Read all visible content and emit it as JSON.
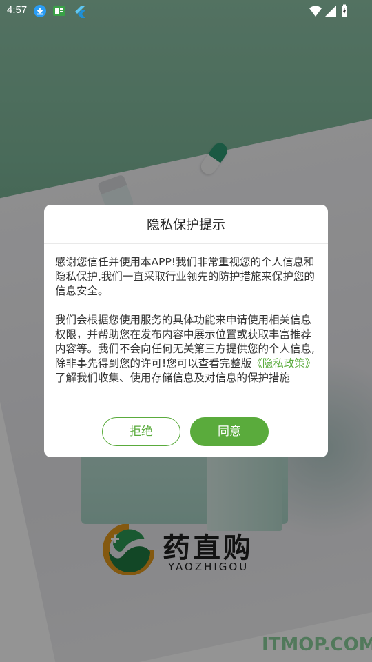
{
  "status_bar": {
    "time": "4:57",
    "left_icons": [
      "download-icon",
      "news-icon",
      "flutter-icon"
    ],
    "right_icons": [
      "wifi-icon",
      "signal-icon",
      "battery-icon"
    ]
  },
  "dialog": {
    "title": "隐私保护提示",
    "paragraph1": "感谢您信任并使用本APP!我们非常重视您的个人信息和隐私保护,我们一直采取行业领先的防护措施来保护您的信息安全。",
    "paragraph2_before": "我们会根据您使用服务的具体功能来申请使用相关信息权限，并帮助您在发布内容中展示位置或获取丰富推荐内容等。我们不会向任何无关第三方提供您的个人信息,除非事先得到您的许可!您可以查看完整版",
    "policy_link": "《隐私政策》",
    "paragraph2_after": "了解我们收集、使用存储信息及对信息的保护措施",
    "reject_label": "拒绝",
    "agree_label": "同意"
  },
  "brand": {
    "name": "药直购",
    "pinyin": "YAOZHIGOU"
  },
  "watermark": "ITMOP.COM",
  "colors": {
    "accent": "#5aab3c",
    "overlay": "rgba(0,0,0,0.42)"
  }
}
